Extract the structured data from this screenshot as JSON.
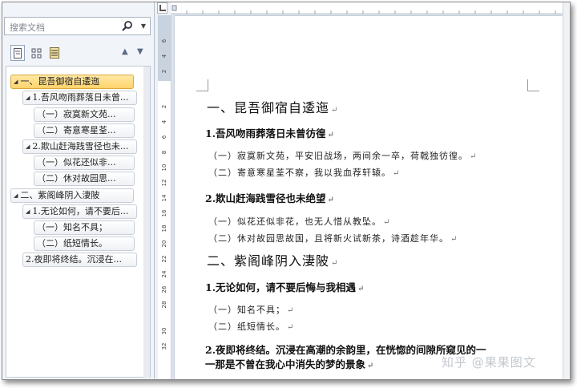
{
  "nav": {
    "search_placeholder": "搜索文档",
    "tree": [
      {
        "label": "一、昆吾御宿自逶迤"
      },
      {
        "label": "1.吾风吻雨葬落日未曾..."
      },
      {
        "label": "（一）寂寞新文苑..."
      },
      {
        "label": "（二）寄意寒星荃..."
      },
      {
        "label": "2.欺山赶海践雪径也未..."
      },
      {
        "label": "（一）似花还似非..."
      },
      {
        "label": "（二）休对故园思..."
      },
      {
        "label": "二、紫阁峰阴入淒陂"
      },
      {
        "label": "1.无论如何，请不要后..."
      },
      {
        "label": "（一）知名不具；"
      },
      {
        "label": "（二）纸短情长。"
      },
      {
        "label": "2.夜即将终结。沉浸在..."
      }
    ]
  },
  "ruler": {
    "vertical_numbers": [
      "6",
      "4",
      "2",
      "",
      "2",
      "4",
      "6",
      "8",
      "10",
      "12",
      "14",
      "16",
      "18",
      "20",
      "22",
      "24",
      "26",
      "28",
      "30",
      "32"
    ]
  },
  "document": {
    "h1_1": "一、昆吾御宿自逶迤",
    "h2_1": "1.吾风吻雨葬落日未曾彷徨",
    "p1": "（一）寂寞新文苑，平安旧战场，两间余一卒，荷戟独彷徨。",
    "p2": "（二）寄意寒星荃不察，我以我血荐轩辕。",
    "h2_2": "2.欺山赶海践雪径也未绝望",
    "p3": "（一）似花还似非花，也无人惜从教坠。",
    "p4": "（二）休对故园思故国，且将新火试新茶，诗酒趁年华。",
    "h1_2": "二、紫阁峰阴入淒陂",
    "h2_3": "1.无论如何，请不要后悔与我相遇",
    "p5": "（一）知名不具；",
    "p6": "（二）纸短情长。",
    "h2_4_line1": "2.夜即将终结。沉浸在高潮的余韵里，在恍惚的间隙所窥见的一",
    "h2_4_line2": "一那是不曾在我心中消失的梦的景象"
  },
  "watermark": "知乎 @果果图文"
}
